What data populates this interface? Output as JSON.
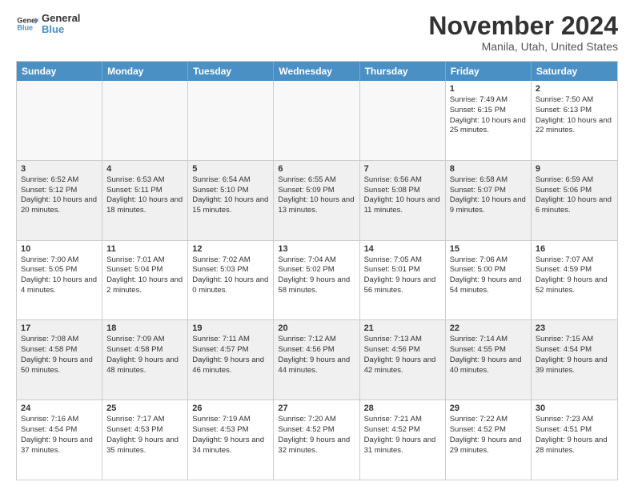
{
  "logo": {
    "line1": "General",
    "line2": "Blue"
  },
  "title": "November 2024",
  "location": "Manila, Utah, United States",
  "days_of_week": [
    "Sunday",
    "Monday",
    "Tuesday",
    "Wednesday",
    "Thursday",
    "Friday",
    "Saturday"
  ],
  "weeks": [
    [
      {
        "day": "",
        "text": "",
        "empty": true
      },
      {
        "day": "",
        "text": "",
        "empty": true
      },
      {
        "day": "",
        "text": "",
        "empty": true
      },
      {
        "day": "",
        "text": "",
        "empty": true
      },
      {
        "day": "",
        "text": "",
        "empty": true
      },
      {
        "day": "1",
        "text": "Sunrise: 7:49 AM\nSunset: 6:15 PM\nDaylight: 10 hours and 25 minutes.",
        "empty": false
      },
      {
        "day": "2",
        "text": "Sunrise: 7:50 AM\nSunset: 6:13 PM\nDaylight: 10 hours and 22 minutes.",
        "empty": false
      }
    ],
    [
      {
        "day": "3",
        "text": "Sunrise: 6:52 AM\nSunset: 5:12 PM\nDaylight: 10 hours and 20 minutes.",
        "empty": false
      },
      {
        "day": "4",
        "text": "Sunrise: 6:53 AM\nSunset: 5:11 PM\nDaylight: 10 hours and 18 minutes.",
        "empty": false
      },
      {
        "day": "5",
        "text": "Sunrise: 6:54 AM\nSunset: 5:10 PM\nDaylight: 10 hours and 15 minutes.",
        "empty": false
      },
      {
        "day": "6",
        "text": "Sunrise: 6:55 AM\nSunset: 5:09 PM\nDaylight: 10 hours and 13 minutes.",
        "empty": false
      },
      {
        "day": "7",
        "text": "Sunrise: 6:56 AM\nSunset: 5:08 PM\nDaylight: 10 hours and 11 minutes.",
        "empty": false
      },
      {
        "day": "8",
        "text": "Sunrise: 6:58 AM\nSunset: 5:07 PM\nDaylight: 10 hours and 9 minutes.",
        "empty": false
      },
      {
        "day": "9",
        "text": "Sunrise: 6:59 AM\nSunset: 5:06 PM\nDaylight: 10 hours and 6 minutes.",
        "empty": false
      }
    ],
    [
      {
        "day": "10",
        "text": "Sunrise: 7:00 AM\nSunset: 5:05 PM\nDaylight: 10 hours and 4 minutes.",
        "empty": false
      },
      {
        "day": "11",
        "text": "Sunrise: 7:01 AM\nSunset: 5:04 PM\nDaylight: 10 hours and 2 minutes.",
        "empty": false
      },
      {
        "day": "12",
        "text": "Sunrise: 7:02 AM\nSunset: 5:03 PM\nDaylight: 10 hours and 0 minutes.",
        "empty": false
      },
      {
        "day": "13",
        "text": "Sunrise: 7:04 AM\nSunset: 5:02 PM\nDaylight: 9 hours and 58 minutes.",
        "empty": false
      },
      {
        "day": "14",
        "text": "Sunrise: 7:05 AM\nSunset: 5:01 PM\nDaylight: 9 hours and 56 minutes.",
        "empty": false
      },
      {
        "day": "15",
        "text": "Sunrise: 7:06 AM\nSunset: 5:00 PM\nDaylight: 9 hours and 54 minutes.",
        "empty": false
      },
      {
        "day": "16",
        "text": "Sunrise: 7:07 AM\nSunset: 4:59 PM\nDaylight: 9 hours and 52 minutes.",
        "empty": false
      }
    ],
    [
      {
        "day": "17",
        "text": "Sunrise: 7:08 AM\nSunset: 4:58 PM\nDaylight: 9 hours and 50 minutes.",
        "empty": false
      },
      {
        "day": "18",
        "text": "Sunrise: 7:09 AM\nSunset: 4:58 PM\nDaylight: 9 hours and 48 minutes.",
        "empty": false
      },
      {
        "day": "19",
        "text": "Sunrise: 7:11 AM\nSunset: 4:57 PM\nDaylight: 9 hours and 46 minutes.",
        "empty": false
      },
      {
        "day": "20",
        "text": "Sunrise: 7:12 AM\nSunset: 4:56 PM\nDaylight: 9 hours and 44 minutes.",
        "empty": false
      },
      {
        "day": "21",
        "text": "Sunrise: 7:13 AM\nSunset: 4:56 PM\nDaylight: 9 hours and 42 minutes.",
        "empty": false
      },
      {
        "day": "22",
        "text": "Sunrise: 7:14 AM\nSunset: 4:55 PM\nDaylight: 9 hours and 40 minutes.",
        "empty": false
      },
      {
        "day": "23",
        "text": "Sunrise: 7:15 AM\nSunset: 4:54 PM\nDaylight: 9 hours and 39 minutes.",
        "empty": false
      }
    ],
    [
      {
        "day": "24",
        "text": "Sunrise: 7:16 AM\nSunset: 4:54 PM\nDaylight: 9 hours and 37 minutes.",
        "empty": false
      },
      {
        "day": "25",
        "text": "Sunrise: 7:17 AM\nSunset: 4:53 PM\nDaylight: 9 hours and 35 minutes.",
        "empty": false
      },
      {
        "day": "26",
        "text": "Sunrise: 7:19 AM\nSunset: 4:53 PM\nDaylight: 9 hours and 34 minutes.",
        "empty": false
      },
      {
        "day": "27",
        "text": "Sunrise: 7:20 AM\nSunset: 4:52 PM\nDaylight: 9 hours and 32 minutes.",
        "empty": false
      },
      {
        "day": "28",
        "text": "Sunrise: 7:21 AM\nSunset: 4:52 PM\nDaylight: 9 hours and 31 minutes.",
        "empty": false
      },
      {
        "day": "29",
        "text": "Sunrise: 7:22 AM\nSunset: 4:52 PM\nDaylight: 9 hours and 29 minutes.",
        "empty": false
      },
      {
        "day": "30",
        "text": "Sunrise: 7:23 AM\nSunset: 4:51 PM\nDaylight: 9 hours and 28 minutes.",
        "empty": false
      }
    ]
  ]
}
